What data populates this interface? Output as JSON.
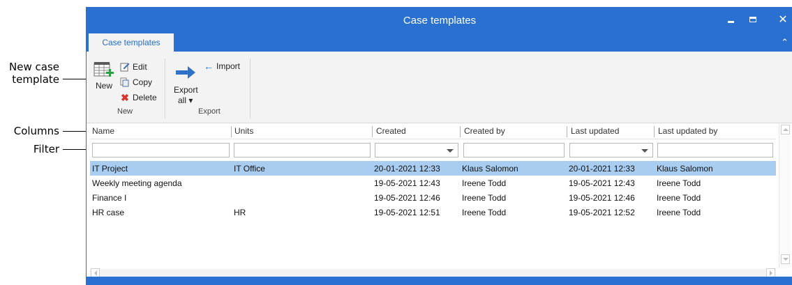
{
  "callouts": {
    "new_case_template_line1": "New case",
    "new_case_template_line2": "template",
    "columns": "Columns",
    "filter": "Filter"
  },
  "window": {
    "title": "Case templates",
    "controls": {
      "minimize": "minimize-icon",
      "maximize": "maximize-icon",
      "close": "✕"
    },
    "accent_color": "#2a70d1"
  },
  "tabs": {
    "active": "Case templates",
    "collapse_glyph": "⌃"
  },
  "ribbon": {
    "new_group": {
      "new_label": "New",
      "edit_label": "Edit",
      "copy_label": "Copy",
      "delete_label": "Delete",
      "group_label": "New"
    },
    "export_group": {
      "export_label_line1": "Export",
      "export_label_line2": "all ▾",
      "import_label": "Import",
      "group_label": "Export"
    }
  },
  "grid": {
    "columns": [
      "Name",
      "Units",
      "Created",
      "Created by",
      "Last updated",
      "Last updated by"
    ],
    "rows": [
      {
        "name": "IT Project",
        "units": "IT Office",
        "created": "20-01-2021 12:33",
        "created_by": "Klaus Salomon",
        "last_updated": "20-01-2021 12:33",
        "last_updated_by": "Klaus Salomon",
        "selected": true
      },
      {
        "name": "Weekly meeting agenda",
        "units": "",
        "created": "19-05-2021 12:43",
        "created_by": "Ireene Todd",
        "last_updated": "19-05-2021 12:43",
        "last_updated_by": "Ireene Todd",
        "selected": false
      },
      {
        "name": "Finance I",
        "units": "",
        "created": "19-05-2021 12:46",
        "created_by": "Ireene Todd",
        "last_updated": "19-05-2021 12:46",
        "last_updated_by": "Ireene Todd",
        "selected": false
      },
      {
        "name": "HR case",
        "units": "HR",
        "created": "19-05-2021 12:51",
        "created_by": "Ireene Todd",
        "last_updated": "19-05-2021 12:52",
        "last_updated_by": "Ireene Todd",
        "selected": false
      }
    ],
    "selection_color": "#a9cdf0"
  }
}
